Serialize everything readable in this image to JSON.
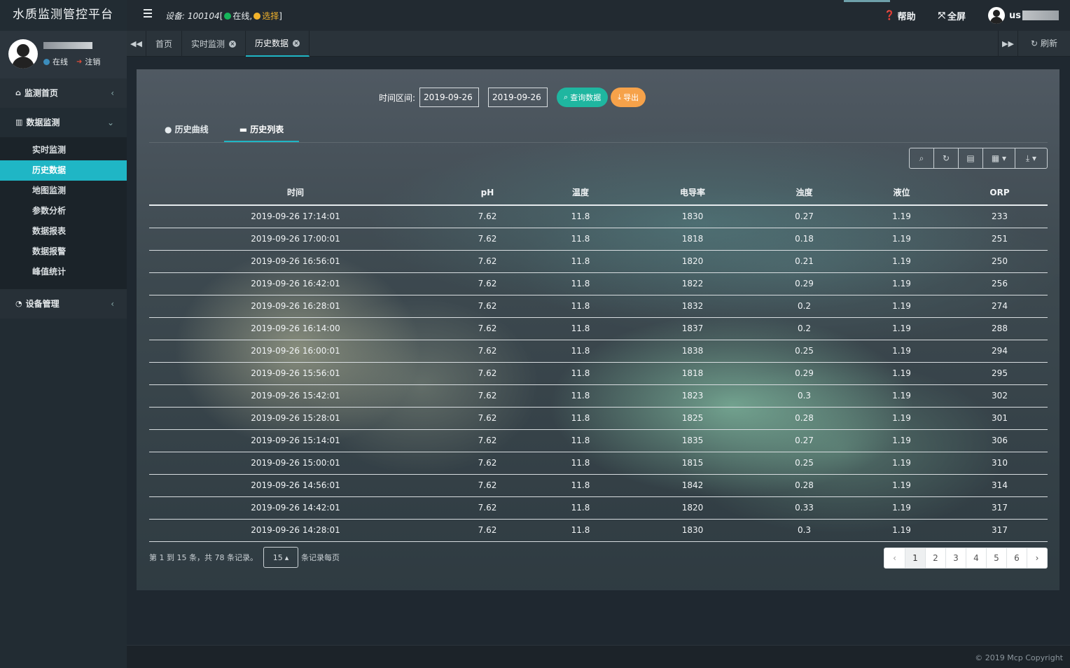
{
  "brand": {
    "title": "水质监测管控平台"
  },
  "user": {
    "status": "在线",
    "logout": "注销"
  },
  "sidebar": {
    "groups": [
      {
        "label": "监测首页",
        "icon": "home-icon"
      },
      {
        "label": "数据监测",
        "icon": "bar-chart-icon"
      },
      {
        "label": "设备管理",
        "icon": "dashboard-icon"
      }
    ],
    "sub_items": [
      "实时监测",
      "历史数据",
      "地图监测",
      "参数分析",
      "数据报表",
      "数据报警",
      "峰值统计"
    ]
  },
  "topbar": {
    "device_label": "设备:",
    "device_id": "100104",
    "bracket_open": "[",
    "online": "在线,",
    "select": "选择",
    "bracket_close": "]",
    "help": "帮助",
    "fullscreen": "全屏",
    "username_prefix": "us"
  },
  "tabs": {
    "items": [
      {
        "label": "首页",
        "closable": false
      },
      {
        "label": "实时监测",
        "closable": true
      },
      {
        "label": "历史数据",
        "closable": true,
        "active": true
      }
    ],
    "refresh": "刷新"
  },
  "filter": {
    "label": "时间区间:",
    "start_date": "2019-09-26",
    "end_date": "2019-09-26",
    "query_button": "查询数据",
    "export_button": "导出"
  },
  "view_tabs": {
    "curve": "历史曲线",
    "list": "历史列表"
  },
  "table": {
    "headers": [
      "时间",
      "pH",
      "温度",
      "电导率",
      "浊度",
      "液位",
      "ORP"
    ],
    "rows": [
      [
        "2019-09-26 17:14:01",
        "7.62",
        "11.8",
        "1830",
        "0.27",
        "1.19",
        "233"
      ],
      [
        "2019-09-26 17:00:01",
        "7.62",
        "11.8",
        "1818",
        "0.18",
        "1.19",
        "251"
      ],
      [
        "2019-09-26 16:56:01",
        "7.62",
        "11.8",
        "1820",
        "0.21",
        "1.19",
        "250"
      ],
      [
        "2019-09-26 16:42:01",
        "7.62",
        "11.8",
        "1822",
        "0.29",
        "1.19",
        "256"
      ],
      [
        "2019-09-26 16:28:01",
        "7.62",
        "11.8",
        "1832",
        "0.2",
        "1.19",
        "274"
      ],
      [
        "2019-09-26 16:14:00",
        "7.62",
        "11.8",
        "1837",
        "0.2",
        "1.19",
        "288"
      ],
      [
        "2019-09-26 16:00:01",
        "7.62",
        "11.8",
        "1838",
        "0.25",
        "1.19",
        "294"
      ],
      [
        "2019-09-26 15:56:01",
        "7.62",
        "11.8",
        "1818",
        "0.29",
        "1.19",
        "295"
      ],
      [
        "2019-09-26 15:42:01",
        "7.62",
        "11.8",
        "1823",
        "0.3",
        "1.19",
        "302"
      ],
      [
        "2019-09-26 15:28:01",
        "7.62",
        "11.8",
        "1825",
        "0.28",
        "1.19",
        "301"
      ],
      [
        "2019-09-26 15:14:01",
        "7.62",
        "11.8",
        "1835",
        "0.27",
        "1.19",
        "306"
      ],
      [
        "2019-09-26 15:00:01",
        "7.62",
        "11.8",
        "1815",
        "0.25",
        "1.19",
        "310"
      ],
      [
        "2019-09-26 14:56:01",
        "7.62",
        "11.8",
        "1842",
        "0.28",
        "1.19",
        "314"
      ],
      [
        "2019-09-26 14:42:01",
        "7.62",
        "11.8",
        "1820",
        "0.33",
        "1.19",
        "317"
      ],
      [
        "2019-09-26 14:28:01",
        "7.62",
        "11.8",
        "1830",
        "0.3",
        "1.19",
        "317"
      ]
    ]
  },
  "pager": {
    "info": "第 1 到 15 条，共 78 条记录。",
    "page_size": "15",
    "per_page_suffix": "条记录每页",
    "prev": "‹",
    "next": "›",
    "pages": [
      "1",
      "2",
      "3",
      "4",
      "5",
      "6"
    ],
    "current": "1"
  },
  "footer": {
    "copyright": "© 2019 Mcp Copyright"
  },
  "colors": {
    "accent": "#1fb6c5",
    "query": "#1fb6a0",
    "export": "#f6a24a",
    "online": "#16b55a"
  }
}
